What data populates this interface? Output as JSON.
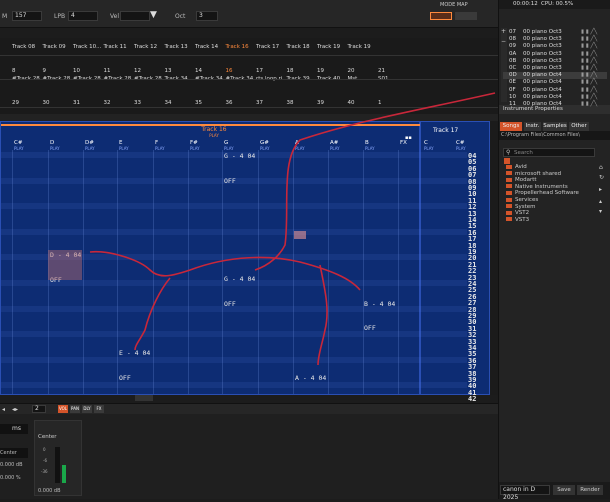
{
  "toolbar": {
    "bpm_label": "M",
    "bpm_value": "157",
    "lpb_label": "LPB",
    "lpb_value": "4",
    "vel_label": "Vel",
    "oct_label": "Oct",
    "oct_value": "3",
    "mode_label": "MODE MAP",
    "time": "00:00:12",
    "cpu": "CPU: 00.5%"
  },
  "tracks_row1": [
    "Track 08",
    "Track 09",
    "Track 10...",
    "Track 11",
    "Track 12",
    "Track 13",
    "Track 14",
    "Track 16",
    "Track 17",
    "Track 18",
    "Track 19",
    "Track 19"
  ],
  "tracks_row2": [
    "8",
    "9",
    "10",
    "11",
    "12",
    "13",
    "14",
    "16",
    "17",
    "18",
    "19",
    "20",
    "21"
  ],
  "tracks_row3": [
    "#Track 28",
    "#Track 28",
    "#Track 28",
    "#Track 28",
    "#Track 28",
    "Track 34",
    "#Track 34",
    "#Track 34",
    "rts loop ri..",
    "Track 39",
    "Track 40",
    "Mst",
    "S01"
  ],
  "tracks_row4": [
    "29",
    "30",
    "31",
    "32",
    "33",
    "34",
    "35",
    "36",
    "37",
    "38",
    "39",
    "40",
    "1"
  ],
  "pattern": {
    "track_title": "Track 16",
    "track_sub": "PLAY",
    "side_title": "Track 17",
    "columns": [
      {
        "n": "C#",
        "p": "PLAY"
      },
      {
        "n": "D",
        "p": "PLAY"
      },
      {
        "n": "D#",
        "p": "PLAY"
      },
      {
        "n": "E",
        "p": "PLAY"
      },
      {
        "n": "F",
        "p": "PLAY"
      },
      {
        "n": "F#",
        "p": "PLAY"
      },
      {
        "n": "G",
        "p": "PLAY"
      },
      {
        "n": "G#",
        "p": "PLAY"
      },
      {
        "n": "A",
        "p": "PLAY"
      },
      {
        "n": "A#",
        "p": "PLAY"
      },
      {
        "n": "B",
        "p": "PLAY"
      },
      {
        "n": "FX",
        "p": ""
      }
    ],
    "side_columns": [
      {
        "n": "C",
        "p": "PLAY"
      },
      {
        "n": "C#",
        "p": "PLAY"
      }
    ],
    "line_numbers": [
      "04",
      "05",
      "06",
      "07",
      "08",
      "09",
      "10",
      "11",
      "12",
      "13",
      "14",
      "15",
      "16",
      "17",
      "18",
      "19",
      "20",
      "21",
      "22",
      "23",
      "24",
      "25",
      "26",
      "27",
      "28",
      "29",
      "30",
      "31",
      "32",
      "33",
      "34",
      "35",
      "36",
      "37",
      "38",
      "39",
      "40",
      "41",
      "42"
    ],
    "notes": [
      {
        "text": "G - 4 04"
      },
      {
        "text": "OFF"
      },
      {
        "text": "D - 4 04"
      },
      {
        "text": "OFF"
      },
      {
        "text": "G - 4 04"
      },
      {
        "text": "OFF"
      },
      {
        "text": "B - 4 04"
      },
      {
        "text": "OFF"
      },
      {
        "text": "E - 4 04"
      },
      {
        "text": "OFF"
      },
      {
        "text": "A - 4 04"
      }
    ]
  },
  "instruments": [
    {
      "idx": "07",
      "name": "00 piano Oct3"
    },
    {
      "idx": "08",
      "name": "00 piano Oct3"
    },
    {
      "idx": "09",
      "name": "00 piano Oct3"
    },
    {
      "idx": "0A",
      "name": "00 piano Oct3"
    },
    {
      "idx": "0B",
      "name": "00 piano Oct3"
    },
    {
      "idx": "0C",
      "name": "00 piano Oct3"
    },
    {
      "idx": "0D",
      "name": "00 piano Oct4"
    },
    {
      "idx": "0E",
      "name": "00 piano Oct4"
    },
    {
      "idx": "0F",
      "name": "00 piano Oct4"
    },
    {
      "idx": "10",
      "name": "00 piano Oct4"
    },
    {
      "idx": "11",
      "name": "00 piano Oct4"
    }
  ],
  "instrument_properties": "Instrument Properties",
  "browser": {
    "tabs": [
      "Songs",
      "Instr.",
      "Samples",
      "Other"
    ],
    "path": "C:\\Program Files\\Common Files\\",
    "search_placeholder": "Search",
    "items": [
      "Avid",
      "microsoft shared",
      "Modartt",
      "Native Instruments",
      "Propellerhead Software",
      "Services",
      "System",
      "VST2",
      "VST3"
    ]
  },
  "bottom": {
    "song_name": "canon in D 2025",
    "save": "Save",
    "render": "Render",
    "ms_value": "ms",
    "center_label": "Center",
    "center_label2": "Center",
    "db_value": "0.000 dB",
    "db_value2": "0.000 dB",
    "pct_value": "0.000 %",
    "meter_ticks": [
      "0",
      "-6",
      "-36"
    ],
    "step_value": "2",
    "btn_labels": [
      "VOL",
      "PAN",
      "DLY",
      "FX"
    ]
  },
  "colors": {
    "accent": "#ff8a3d",
    "pattern_bg": "#0d2c73",
    "annotation": "#c8273a"
  }
}
